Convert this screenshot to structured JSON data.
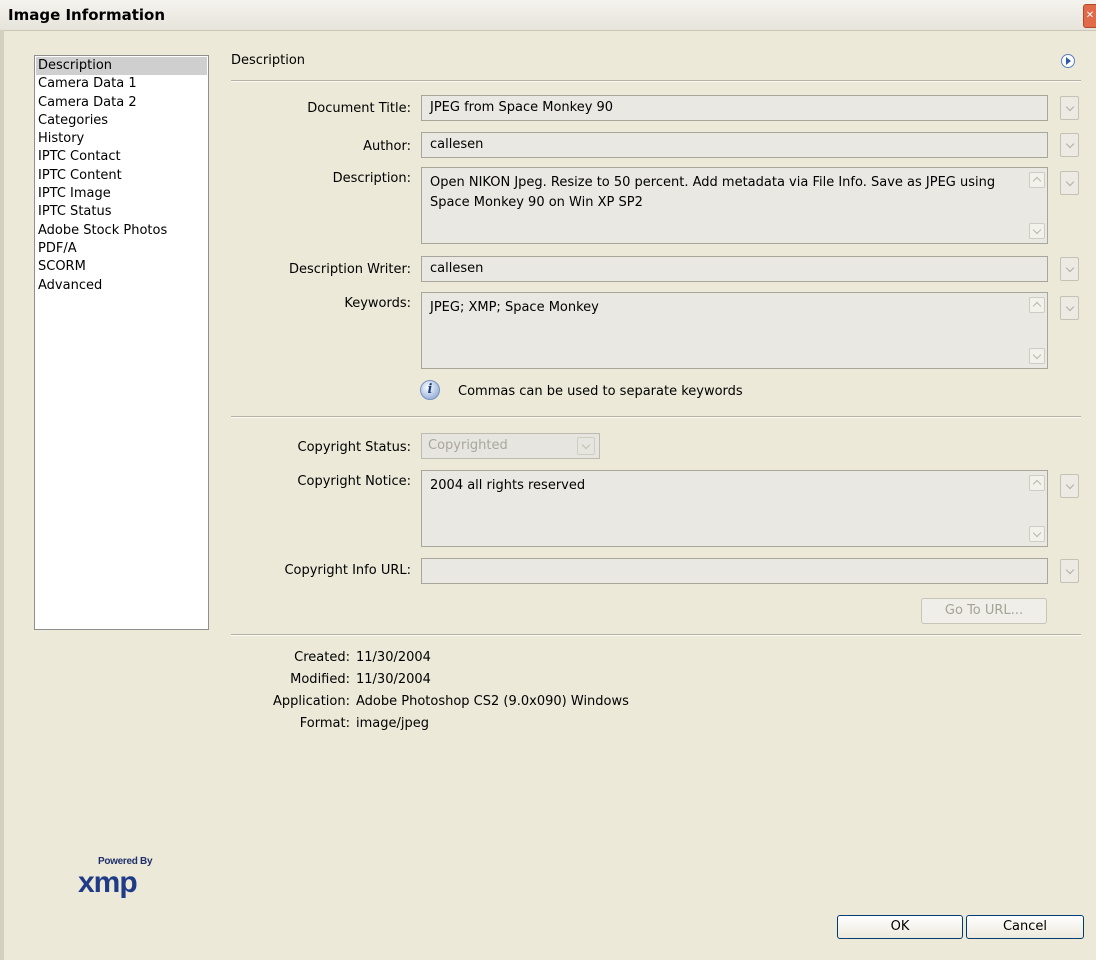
{
  "window": {
    "title": "Image Information"
  },
  "sidebar": {
    "items": [
      {
        "label": "Description",
        "selected": true
      },
      {
        "label": "Camera Data 1"
      },
      {
        "label": "Camera Data 2"
      },
      {
        "label": "Categories"
      },
      {
        "label": "History"
      },
      {
        "label": "IPTC Contact"
      },
      {
        "label": "IPTC Content"
      },
      {
        "label": "IPTC Image"
      },
      {
        "label": "IPTC Status"
      },
      {
        "label": "Adobe Stock Photos"
      },
      {
        "label": "PDF/A"
      },
      {
        "label": "SCORM"
      },
      {
        "label": "Advanced"
      }
    ]
  },
  "panel": {
    "title": "Description",
    "fields": {
      "document_title": {
        "label": "Document Title:",
        "value": "JPEG from Space Monkey 90"
      },
      "author": {
        "label": "Author:",
        "value": "callesen"
      },
      "description": {
        "label": "Description:",
        "value": "Open NIKON Jpeg. Resize to 50 percent. Add metadata via File Info. Save as JPEG using Space Monkey 90 on Win XP  SP2"
      },
      "description_writer": {
        "label": "Description Writer:",
        "value": "callesen"
      },
      "keywords": {
        "label": "Keywords:",
        "value": "JPEG; XMP; Space Monkey"
      },
      "keywords_hint": "Commas can be used to separate keywords",
      "copyright_status": {
        "label": "Copyright Status:",
        "value": "Copyrighted"
      },
      "copyright_notice": {
        "label": "Copyright Notice:",
        "value": "2004 all rights reserved"
      },
      "copyright_url": {
        "label": "Copyright Info URL:",
        "value": ""
      },
      "goto_url_label": "Go To URL..."
    },
    "metadata": {
      "created": {
        "label": "Created:",
        "value": "11/30/2004"
      },
      "modified": {
        "label": "Modified:",
        "value": "11/30/2004"
      },
      "application": {
        "label": "Application:",
        "value": "Adobe Photoshop CS2 (9.0x090)  Windows"
      },
      "format": {
        "label": "Format:",
        "value": "image/jpeg"
      }
    }
  },
  "logo": {
    "powered_by": "Powered By",
    "mark": "xmp"
  },
  "buttons": {
    "ok": "OK",
    "cancel": "Cancel"
  }
}
